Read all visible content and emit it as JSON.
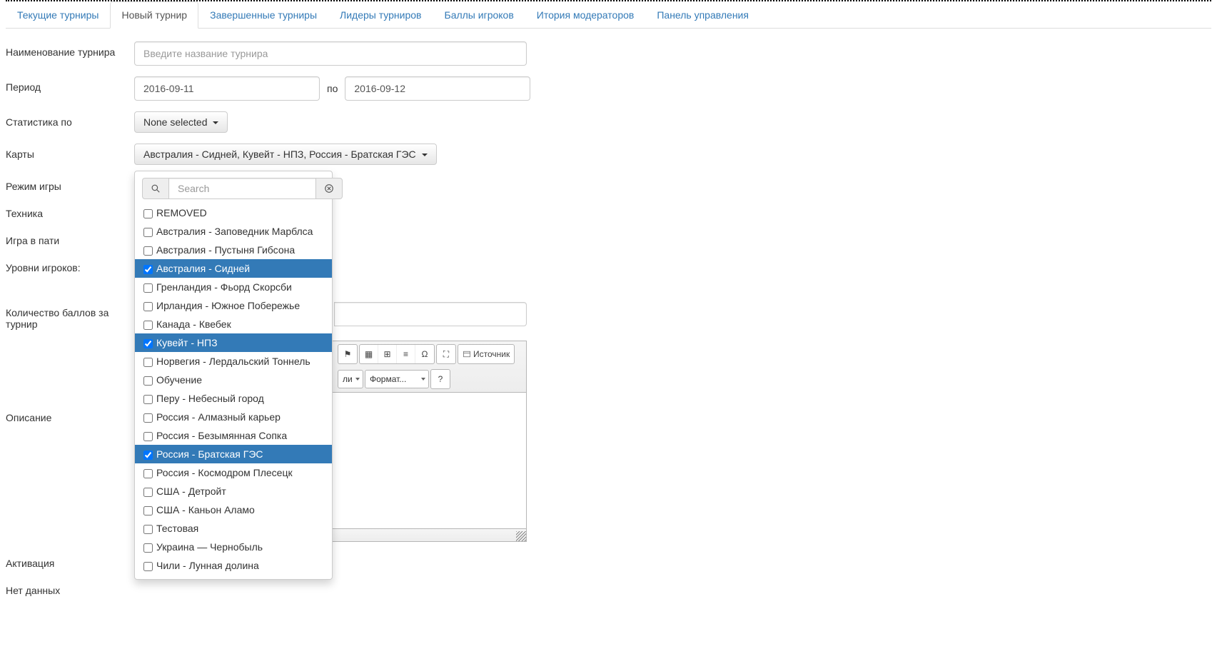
{
  "tabs": [
    {
      "label": "Текущие турниры",
      "active": false
    },
    {
      "label": "Новый турнир",
      "active": true
    },
    {
      "label": "Завершенные турниры",
      "active": false
    },
    {
      "label": "Лидеры турниров",
      "active": false
    },
    {
      "label": "Баллы игроков",
      "active": false
    },
    {
      "label": "Итория модераторов",
      "active": false
    },
    {
      "label": "Панель управления",
      "active": false
    }
  ],
  "form": {
    "tournament_name_label": "Наименование турнира",
    "tournament_name_placeholder": "Введите название турнира",
    "period_label": "Период",
    "period_from_value": "2016-09-11",
    "period_between": "по",
    "period_to_value": "2016-09-12",
    "stats_label": "Статистика по",
    "stats_selected": "None selected",
    "maps_label": "Карты",
    "maps_selected": "Австралия - Сидней, Кувейт - НПЗ, Россия - Братская ГЭС",
    "game_mode_label": "Режим игры",
    "tech_label": "Техника",
    "party_label": "Игра в пати",
    "levels_label": "Уровни игроков:",
    "points_label": "Количество баллов за турнир",
    "description_label": "Описание",
    "activation_label": "Активация",
    "no_data": "Нет данных"
  },
  "maps_dropdown": {
    "search_placeholder": "Search",
    "items": [
      {
        "label": "REMOVED",
        "selected": false
      },
      {
        "label": "Австралия - Заповедник Марблса",
        "selected": false
      },
      {
        "label": "Австралия - Пустыня Гибсона",
        "selected": false
      },
      {
        "label": "Австралия - Сидней",
        "selected": true
      },
      {
        "label": "Гренландия - Фьорд Скорсби",
        "selected": false
      },
      {
        "label": "Ирландия - Южное Побережье",
        "selected": false
      },
      {
        "label": "Канада - Квебек",
        "selected": false
      },
      {
        "label": "Кувейт - НПЗ",
        "selected": true
      },
      {
        "label": "Норвегия - Лердальский Тоннель",
        "selected": false
      },
      {
        "label": "Обучение",
        "selected": false
      },
      {
        "label": "Перу - Небесный город",
        "selected": false
      },
      {
        "label": "Россия - Алмазный карьер",
        "selected": false
      },
      {
        "label": "Россия - Безымянная Сопка",
        "selected": false
      },
      {
        "label": "Россия - Братская ГЭС",
        "selected": true
      },
      {
        "label": "Россия - Космодром Плесецк",
        "selected": false
      },
      {
        "label": "США - Детройт",
        "selected": false
      },
      {
        "label": "США - Каньон Аламо",
        "selected": false
      },
      {
        "label": "Тестовая",
        "selected": false
      },
      {
        "label": "Украина — Чернобыль",
        "selected": false
      },
      {
        "label": "Чили - Лунная долина",
        "selected": false
      }
    ]
  },
  "editor": {
    "style_combo_suffix": "ли",
    "format_combo": "Формат...",
    "source_label": "Источник",
    "help_label": "?"
  }
}
